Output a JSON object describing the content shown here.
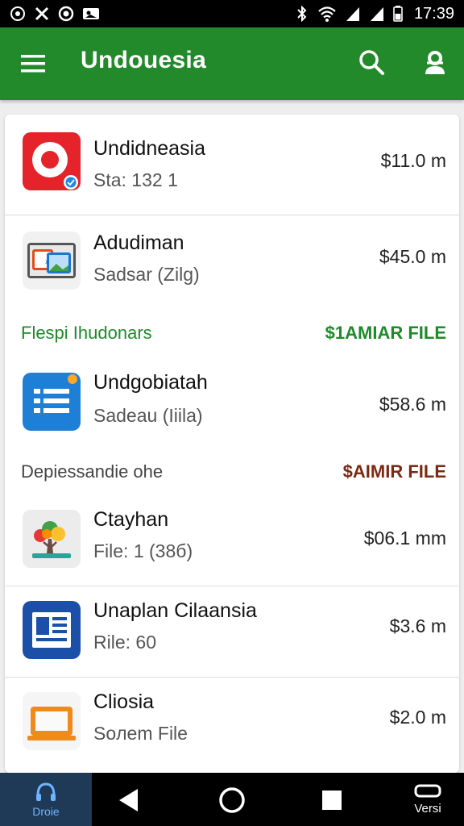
{
  "status_bar": {
    "time": "17:39",
    "left_icons": [
      "settings-circle-icon",
      "tools-icon",
      "record-icon",
      "photo-icon"
    ],
    "right_icons": [
      "bluetooth-icon",
      "wifi-icon",
      "signal-icon",
      "signal-icon",
      "battery-icon"
    ]
  },
  "app_bar": {
    "title": "Undouesia",
    "color": "#238a2c"
  },
  "list": {
    "items": [
      {
        "name": "Undidneasia",
        "meta": "Sta: 132 1",
        "price": "$11.0 m",
        "icon": "red-ring-app-icon"
      },
      {
        "name": "Adudiman",
        "meta": "Sadsar (Zilg)",
        "price": "$45.0 m",
        "icon": "photo-folder-icon"
      }
    ],
    "section_1": {
      "label": "Flespi Ihudonars",
      "action": "$1AMIAR FILE",
      "label_color": "#1e8a2a",
      "action_color": "#1e8a2a"
    },
    "items_2": [
      {
        "name": "Undgobiatah",
        "meta": "Sadeau (Iiila)",
        "price": "$58.6 m",
        "icon": "list-document-icon"
      }
    ],
    "section_2": {
      "label": "Depiessandie ohe",
      "action": "$AIMIR FILE",
      "label_color": "#444444",
      "action_color": "#7a2a10"
    },
    "items_3": [
      {
        "name": "Ctayhan",
        "meta": "File: 1 (38б)",
        "price": "$06.1 mm",
        "icon": "tree-icon"
      },
      {
        "name": "Unaplan Cilaansia",
        "meta": "Rile: 60",
        "price": "$3.6 m",
        "icon": "newspaper-icon"
      },
      {
        "name": "Cliosia",
        "meta": "Soлem File",
        "price": "$2.0 m",
        "icon": "laptop-icon"
      }
    ]
  },
  "nav_bar": {
    "home_label": "Droie",
    "right_label": "Versi"
  }
}
